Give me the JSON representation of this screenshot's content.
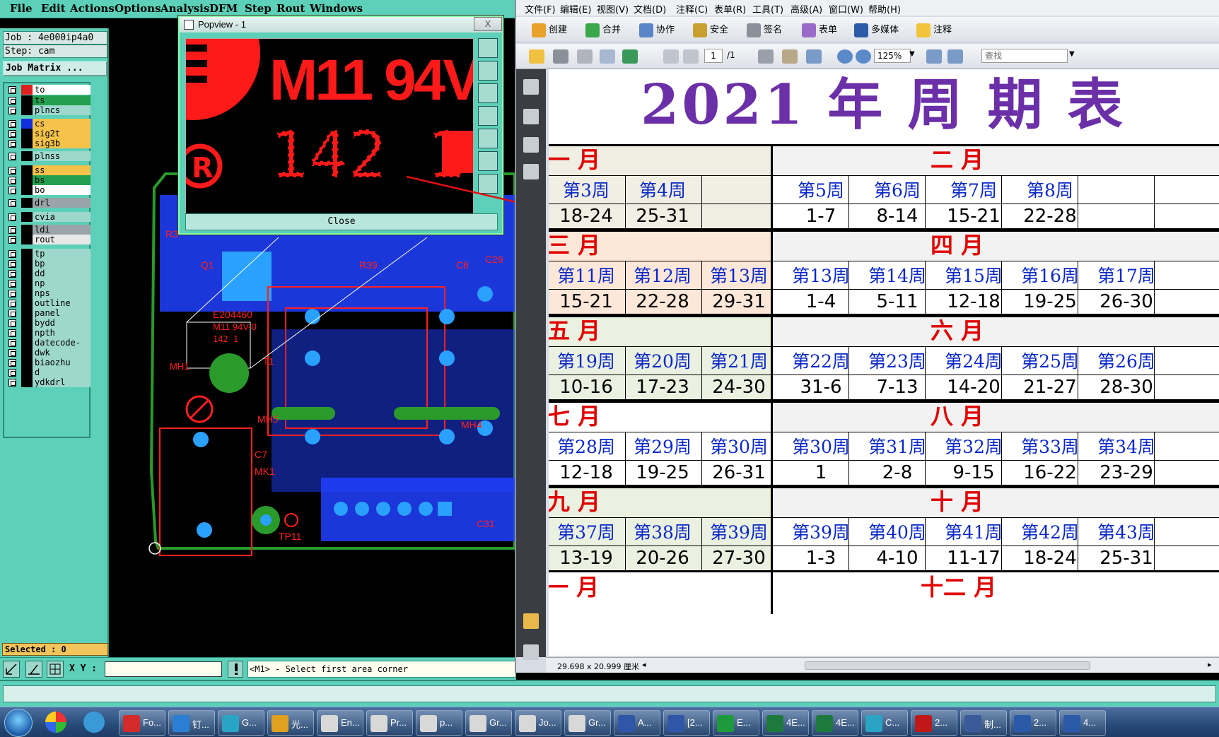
{
  "genesis": {
    "menu": [
      "File",
      "Edit",
      "Actions",
      "Options",
      "Analysis",
      "DFM",
      "Step",
      "Rout",
      "Windows"
    ],
    "job_label": "Job : 4e000ip4a0",
    "step_label": "Step: cam",
    "job_matrix_button": "Job Matrix ...",
    "layers": [
      {
        "name": "to",
        "color": "#ffffff"
      },
      {
        "name": "ts",
        "color": "#22a050"
      },
      {
        "name": "plncs",
        "color": "#9ed8cc"
      },
      {
        "name": "cs",
        "color": "#f5c24a"
      },
      {
        "name": "sig2t",
        "color": "#f5c24a"
      },
      {
        "name": "sig3b",
        "color": "#f5c24a"
      },
      {
        "name": "plnss",
        "color": "#9ed8cc"
      },
      {
        "name": "ss",
        "color": "#f5c24a"
      },
      {
        "name": "bs",
        "color": "#22a050"
      },
      {
        "name": "bo",
        "color": "#ffffff"
      },
      {
        "name": "drl",
        "color": "#9aa3a8"
      },
      {
        "name": "cvia",
        "color": "#9ed8cc"
      },
      {
        "name": "ldi",
        "color": "#9aa3a8"
      },
      {
        "name": "rout",
        "color": "#e8e8e8"
      },
      {
        "name": "tp",
        "color": "#9ed8cc"
      },
      {
        "name": "bp",
        "color": "#9ed8cc"
      },
      {
        "name": "dd",
        "color": "#9ed8cc"
      },
      {
        "name": "np",
        "color": "#9ed8cc"
      },
      {
        "name": "nps",
        "color": "#9ed8cc"
      },
      {
        "name": "outline",
        "color": "#9ed8cc"
      },
      {
        "name": "panel",
        "color": "#9ed8cc"
      },
      {
        "name": "bydd",
        "color": "#9ed8cc"
      },
      {
        "name": "npth",
        "color": "#9ed8cc"
      },
      {
        "name": "datecode-to",
        "color": "#9ed8cc"
      },
      {
        "name": "dwk",
        "color": "#9ed8cc"
      },
      {
        "name": "biaozhu",
        "color": "#9ed8cc"
      },
      {
        "name": "d",
        "color": "#9ed8cc"
      },
      {
        "name": "ydkdrl",
        "color": "#9ed8cc"
      }
    ],
    "selected_label": "Selected : 0",
    "xy_label": "X Y :",
    "xy_value": "",
    "prompt_message": "<M1> - Select first area corner",
    "board_labels": [
      "Q1",
      "R39",
      "C8",
      "C29",
      "R3",
      "E204460",
      "M11 94V-0",
      "142 1",
      "MH1",
      "T1",
      "MH5",
      "C7",
      "MK1",
      "TP11",
      "C31",
      "MH4"
    ]
  },
  "popview": {
    "title": "Popview - 1",
    "close_x": "X",
    "zoom_text_line1": "M11 94V",
    "zoom_text_line2": "142 1",
    "close_button": "Close"
  },
  "acrobat": {
    "menu": [
      "文件(F)",
      "编辑(E)",
      "视图(V)",
      "文档(D)",
      "注释(C)",
      "表单(R)",
      "工具(T)",
      "高级(A)",
      "窗口(W)",
      "帮助(H)"
    ],
    "toolbar1": [
      "创建",
      "合并",
      "协作",
      "安全",
      "签名",
      "表单",
      "多媒体",
      "注释"
    ],
    "page_current": "1",
    "page_total": "/1",
    "zoom": "125%",
    "find_placeholder": "查找",
    "page_size": "29.698 x 20.999 厘米"
  },
  "calendar": {
    "title": "2021 年 周 期 表",
    "rows": [
      {
        "left_month": "一  月",
        "right_month": "二  月",
        "weeks": [
          "第3周",
          "第4周",
          "",
          "第5周",
          "第6周",
          "第7周",
          "第8周",
          ""
        ],
        "dates": [
          "18-24",
          "25-31",
          "",
          "1-7",
          "8-14",
          "15-21",
          "22-28",
          ""
        ]
      },
      {
        "left_month": "三  月",
        "right_month": "四  月",
        "weeks": [
          "第11周",
          "第12周",
          "第13周",
          "第13周",
          "第14周",
          "第15周",
          "第16周",
          "第17周"
        ],
        "dates": [
          "15-21",
          "22-28",
          "29-31",
          "1-4",
          "5-11",
          "12-18",
          "19-25",
          "26-30"
        ]
      },
      {
        "left_month": "五  月",
        "right_month": "六  月",
        "weeks": [
          "第19周",
          "第20周",
          "第21周",
          "第22周",
          "第23周",
          "第24周",
          "第25周",
          "第26周"
        ],
        "dates": [
          "10-16",
          "17-23",
          "24-30",
          "31-6",
          "7-13",
          "14-20",
          "21-27",
          "28-30"
        ]
      },
      {
        "left_month": "七  月",
        "right_month": "八  月",
        "weeks": [
          "第28周",
          "第29周",
          "第30周",
          "第30周",
          "第31周",
          "第32周",
          "第33周",
          "第34周"
        ],
        "dates": [
          "12-18",
          "19-25",
          "26-31",
          "1",
          "2-8",
          "9-15",
          "16-22",
          "23-29"
        ]
      },
      {
        "left_month": "九  月",
        "right_month": "十  月",
        "weeks": [
          "第37周",
          "第38周",
          "第39周",
          "第39周",
          "第40周",
          "第41周",
          "第42周",
          "第43周"
        ],
        "dates": [
          "13-19",
          "20-26",
          "27-30",
          "1-3",
          "4-10",
          "11-17",
          "18-24",
          "25-31"
        ]
      }
    ],
    "last_left_month": "一  月",
    "last_right_month": "十二  月",
    "row_colors": [
      "#f1efe3",
      "#fde7d9",
      "#eaf1e0",
      "#ffffff",
      "#eaf1e0"
    ]
  },
  "taskbar": [
    {
      "label": "Fo...",
      "color": "#d42a2a"
    },
    {
      "label": "钉...",
      "color": "#2a7fd4"
    },
    {
      "label": "G...",
      "color": "#2aa4c4"
    },
    {
      "label": "光...",
      "color": "#e0a020"
    },
    {
      "label": "En...",
      "color": "#d8d8d8"
    },
    {
      "label": "Pr...",
      "color": "#d8d8d8"
    },
    {
      "label": "p...",
      "color": "#d8d8d8"
    },
    {
      "label": "Gr...",
      "color": "#d8d8d8"
    },
    {
      "label": "Jo...",
      "color": "#d8d8d8"
    },
    {
      "label": "Gr...",
      "color": "#d8d8d8"
    },
    {
      "label": "A...",
      "color": "#3056a8"
    },
    {
      "label": "[2...",
      "color": "#3056a8"
    },
    {
      "label": "E...",
      "color": "#1e9a3c"
    },
    {
      "label": "4E...",
      "color": "#1e7a3c"
    },
    {
      "label": "4E...",
      "color": "#1e7a3c"
    },
    {
      "label": "C...",
      "color": "#2aa4c4"
    },
    {
      "label": "2...",
      "color": "#c01818"
    },
    {
      "label": "制...",
      "color": "#3a5a9a"
    },
    {
      "label": "2...",
      "color": "#2a5aa8"
    },
    {
      "label": "4...",
      "color": "#2a5aa8"
    }
  ]
}
